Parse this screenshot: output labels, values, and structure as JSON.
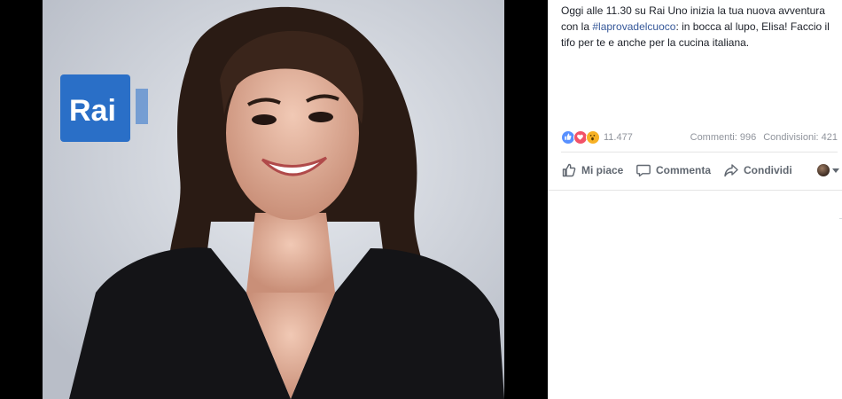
{
  "photo": {
    "alt_logo": "Rai",
    "colors": {
      "backdrop": "#cfd4dd",
      "rai_blue": "#2a6fc7",
      "hair": "#2a1b14",
      "dress": "#141417"
    }
  },
  "post": {
    "caption_before": "Oggi alle 11.30 su Rai Uno inizia la tua nuova avventura con la ",
    "hashtag": "#laprovadelcuoco",
    "caption_after": ": in bocca al lupo, Elisa! Faccio il tifo per te e anche per la cucina italiana."
  },
  "reactions": {
    "icons": [
      "like-icon",
      "love-icon",
      "wow-icon"
    ],
    "count": "11.477",
    "comments": "Commenti: 996",
    "shares": "Condivisioni: 421"
  },
  "actions": {
    "like": "Mi piace",
    "comment": "Commenta",
    "share": "Condividi"
  },
  "colors": {
    "link": "#365899",
    "text": "#1d2129",
    "muted": "#90949c",
    "action": "#606770"
  }
}
